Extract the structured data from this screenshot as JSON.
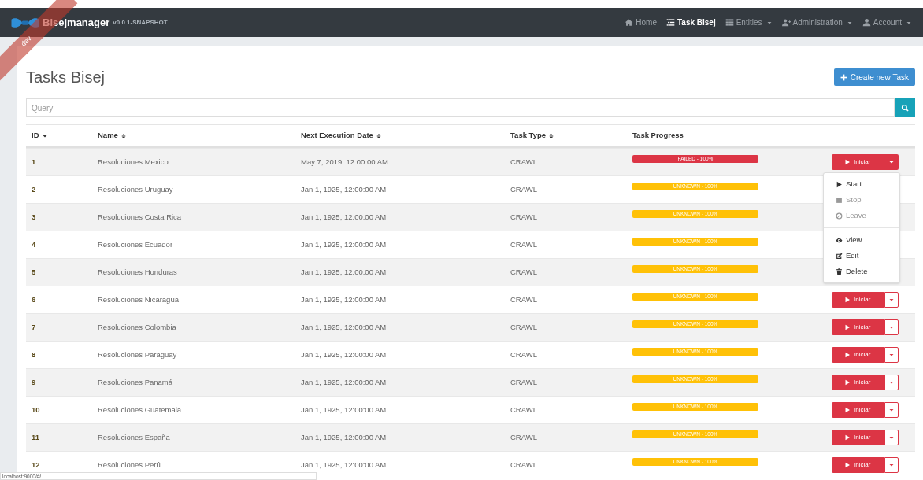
{
  "navbar": {
    "brand": "Bisejmanager",
    "version": "v0.0.1-SNAPSHOT",
    "ribbon": "dev",
    "items": [
      {
        "label": "Home",
        "dropdown": false,
        "selected": false
      },
      {
        "label": "Task Bisej",
        "dropdown": false,
        "selected": true
      },
      {
        "label": "Entities",
        "dropdown": true,
        "selected": false
      },
      {
        "label": "Administration",
        "dropdown": true,
        "selected": false
      },
      {
        "label": "Account",
        "dropdown": true,
        "selected": false
      }
    ]
  },
  "page": {
    "title": "Tasks Bisej",
    "create_button": "Create new Task",
    "search": {
      "placeholder": "Query"
    }
  },
  "table": {
    "columns": [
      {
        "label": "ID",
        "kind": "sorted"
      },
      {
        "label": "Name",
        "kind": "sortable"
      },
      {
        "label": "Next Execution Date",
        "kind": "sortable"
      },
      {
        "label": "Task Type",
        "kind": "sortable"
      },
      {
        "label": "Task Progress",
        "kind": "plain"
      }
    ],
    "rows": [
      {
        "id": "1",
        "name": "Resoluciones Mexico",
        "date": "May 7, 2019, 12:00:00 AM",
        "type": "CRAWL",
        "progress": {
          "color": "#dc3545",
          "label": "FAILED - 100%",
          "level": 1
        },
        "button": "Iniciar",
        "menu_open": true
      },
      {
        "id": "2",
        "name": "Resoluciones Uruguay",
        "date": "Jan 1, 1925, 12:00:00 AM",
        "type": "CRAWL",
        "progress": {
          "color": "#ffc107",
          "label": "UNKNOWN - 100%",
          "level": 1
        }
      },
      {
        "id": "3",
        "name": "Resoluciones Costa Rica",
        "date": "Jan 1, 1925, 12:00:00 AM",
        "type": "CRAWL",
        "progress": {
          "color": "#ffc107",
          "label": "UNKNOWN - 100%",
          "level": 1
        }
      },
      {
        "id": "4",
        "name": "Resoluciones Ecuador",
        "date": "Jan 1, 1925, 12:00:00 AM",
        "type": "CRAWL",
        "progress": {
          "color": "#ffc107",
          "label": "UNKNOWN - 100%",
          "level": 1
        }
      },
      {
        "id": "5",
        "name": "Resoluciones Honduras",
        "date": "Jan 1, 1925, 12:00:00 AM",
        "type": "CRAWL",
        "progress": {
          "color": "#ffc107",
          "label": "UNKNOWN - 100%",
          "level": 1
        }
      },
      {
        "id": "6",
        "name": "Resoluciones Nicaragua",
        "date": "Jan 1, 1925, 12:00:00 AM",
        "type": "CRAWL",
        "progress": {
          "color": "#ffc107",
          "label": "UNKNOWN - 100%",
          "level": 1
        },
        "button": "Iniciar",
        "menu_open": false
      },
      {
        "id": "7",
        "name": "Resoluciones Colombia",
        "date": "Jan 1, 1925, 12:00:00 AM",
        "type": "CRAWL",
        "progress": {
          "color": "#ffc107",
          "label": "UNKNOWN - 100%",
          "level": 1
        },
        "button": "Iniciar",
        "menu_open": false
      },
      {
        "id": "8",
        "name": "Resoluciones Paraguay",
        "date": "Jan 1, 1925, 12:00:00 AM",
        "type": "CRAWL",
        "progress": {
          "color": "#ffc107",
          "label": "UNKNOWN - 100%",
          "level": 1
        },
        "button": "Iniciar",
        "menu_open": false
      },
      {
        "id": "9",
        "name": "Resoluciones Panamá",
        "date": "Jan 1, 1925, 12:00:00 AM",
        "type": "CRAWL",
        "progress": {
          "color": "#ffc107",
          "label": "UNKNOWN - 100%",
          "level": 1
        },
        "button": "Iniciar",
        "menu_open": false
      },
      {
        "id": "10",
        "name": "Resoluciones Guatemala",
        "date": "Jan 1, 1925, 12:00:00 AM",
        "type": "CRAWL",
        "progress": {
          "color": "#ffc107",
          "label": "UNKNOWN - 100%",
          "level": 1
        },
        "button": "Iniciar",
        "menu_open": false
      },
      {
        "id": "11",
        "name": "Resoluciones España",
        "date": "Jan 1, 1925, 12:00:00 AM",
        "type": "CRAWL",
        "progress": {
          "color": "#ffc107",
          "label": "UNKNOWN - 100%",
          "level": 1
        },
        "button": "Iniciar",
        "menu_open": false
      },
      {
        "id": "12",
        "name": "Resoluciones Perú",
        "date": "Jan 1, 1925, 12:00:00 AM",
        "type": "CRAWL",
        "progress": {
          "color": "#ffc107",
          "label": "UNKNOWN - 100%",
          "level": 1
        },
        "button": "Iniciar",
        "menu_open": false
      }
    ]
  },
  "dropdown_menu": {
    "items": [
      {
        "kind": "item",
        "label": "Start",
        "disabled": false
      },
      {
        "kind": "item",
        "label": "Stop",
        "disabled": true
      },
      {
        "kind": "item",
        "label": "Leave",
        "disabled": true
      },
      {
        "kind": "divider"
      },
      {
        "kind": "item",
        "label": "View",
        "disabled": false
      },
      {
        "kind": "item",
        "label": "Edit",
        "disabled": false
      },
      {
        "kind": "item",
        "label": "Delete",
        "disabled": false
      }
    ]
  },
  "status_bar": {
    "url": "localhost:9000/#/"
  }
}
